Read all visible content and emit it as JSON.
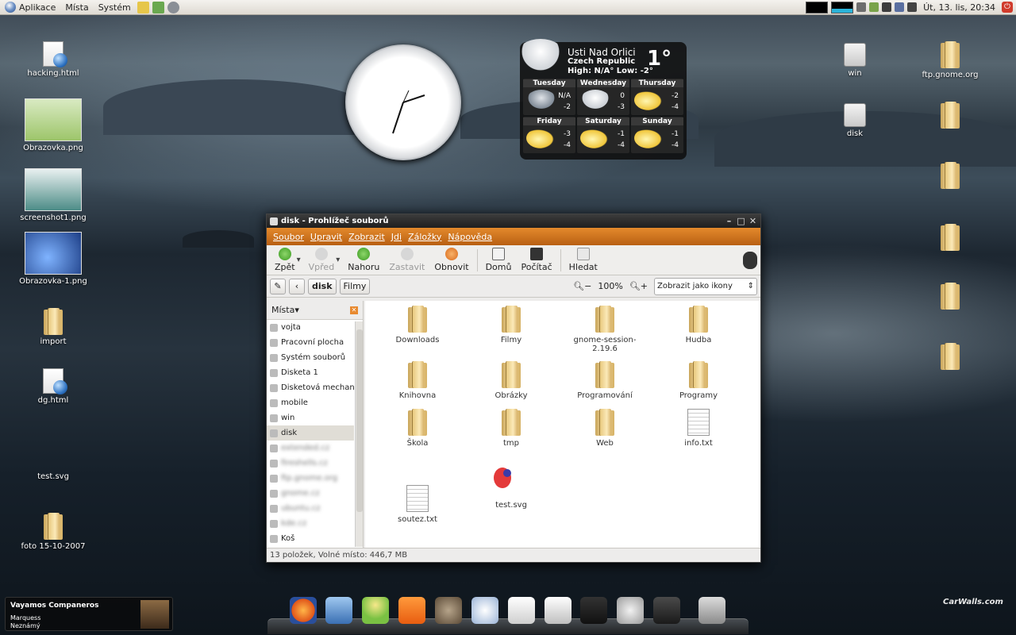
{
  "panel": {
    "menus": [
      "Aplikace",
      "Místa",
      "Systém"
    ],
    "clock": "Út, 13. lis, 20:34"
  },
  "desktop_left": [
    {
      "label": "hacking.html",
      "kind": "html"
    },
    {
      "label": "Obrazovka.png",
      "kind": "thumb-green"
    },
    {
      "label": "screenshot1.png",
      "kind": "thumb-teal"
    },
    {
      "label": "Obrazovka-1.png",
      "kind": "thumb-blue"
    },
    {
      "label": "import",
      "kind": "folder"
    },
    {
      "label": "dg.html",
      "kind": "html"
    },
    {
      "label": "test.svg",
      "kind": "blank"
    },
    {
      "label": "foto 15-10-2007",
      "kind": "folder"
    }
  ],
  "desktop_right": [
    {
      "label": "win",
      "kind": "drive"
    },
    {
      "label": "disk",
      "kind": "drive"
    },
    {
      "label": "ftp.gnome.org",
      "kind": "folder"
    }
  ],
  "weather": {
    "city": "Usti Nad Orlici",
    "country": "Czech Republic",
    "hilo": "High: N/A°   Low: -2°",
    "temp": "1°",
    "days": [
      {
        "name": "Tuesday",
        "hi": "N/A",
        "lo": "-2",
        "icon": "rain"
      },
      {
        "name": "Wednesday",
        "hi": "0",
        "lo": "-3",
        "icon": "snow"
      },
      {
        "name": "Thursday",
        "hi": "-2",
        "lo": "-4",
        "icon": "sun"
      },
      {
        "name": "Friday",
        "hi": "-3",
        "lo": "-4",
        "icon": "sun"
      },
      {
        "name": "Saturday",
        "hi": "-1",
        "lo": "-4",
        "icon": "sun"
      },
      {
        "name": "Sunday",
        "hi": "-1",
        "lo": "-4",
        "icon": "sun"
      }
    ]
  },
  "window": {
    "title": "disk - Prohlížeč souborů",
    "menu": [
      "Soubor",
      "Upravit",
      "Zobrazit",
      "Jdi",
      "Záložky",
      "Nápověda"
    ],
    "toolbar": {
      "back": "Zpět",
      "forward": "Vpřed",
      "up": "Nahoru",
      "stop": "Zastavit",
      "reload": "Obnovit",
      "home": "Domů",
      "computer": "Počítač",
      "search": "Hledat"
    },
    "path": {
      "current": "disk",
      "child": "Filmy"
    },
    "zoom": "100%",
    "view": "Zobrazit jako ikony",
    "sidebar_title": "Místa",
    "places": [
      {
        "label": "vojta",
        "blur": false
      },
      {
        "label": "Pracovní plocha",
        "blur": false
      },
      {
        "label": "Systém souborů",
        "blur": false
      },
      {
        "label": "Disketa 1",
        "blur": false
      },
      {
        "label": "Disketová mechani",
        "blur": false
      },
      {
        "label": "mobile",
        "blur": false
      },
      {
        "label": "win",
        "blur": false
      },
      {
        "label": "disk",
        "blur": false,
        "selected": true
      },
      {
        "label": "extended.cz",
        "blur": true
      },
      {
        "label": "fireshells.cz",
        "blur": true
      },
      {
        "label": "ftp.gnome.org",
        "blur": true
      },
      {
        "label": "gnome.cz",
        "blur": true
      },
      {
        "label": "ubuntu.cz",
        "blur": true
      },
      {
        "label": "kde.cz",
        "blur": true
      },
      {
        "label": "Koš",
        "blur": false
      }
    ],
    "files": [
      {
        "label": "Downloads",
        "kind": "folder"
      },
      {
        "label": "Filmy",
        "kind": "folder"
      },
      {
        "label": "gnome-session-2.19.6",
        "kind": "folder"
      },
      {
        "label": "Hudba",
        "kind": "folder"
      },
      {
        "label": "Knihovna",
        "kind": "folder"
      },
      {
        "label": "Obrázky",
        "kind": "folder"
      },
      {
        "label": "Programování",
        "kind": "folder"
      },
      {
        "label": "Programy",
        "kind": "folder"
      },
      {
        "label": "Škola",
        "kind": "folder"
      },
      {
        "label": "tmp",
        "kind": "folder"
      },
      {
        "label": "Web",
        "kind": "folder"
      },
      {
        "label": "info.txt",
        "kind": "txt"
      },
      {
        "label": "soutez.txt",
        "kind": "txt"
      },
      {
        "label": "test.svg",
        "kind": "svg"
      }
    ],
    "status": "13 položek, Volné místo: 446,7 MB"
  },
  "music": {
    "title": "Vayamos Companeros",
    "artist": "Marquess",
    "album": "Neznámý"
  },
  "dock_icons": [
    "firefox-icon",
    "mail-icon",
    "pidgin-icon",
    "rss-icon",
    "gimp-icon",
    "clock-icon",
    "media-icon",
    "ipod-icon",
    "terminal-icon",
    "search-icon",
    "drive-icon",
    "trash-icon"
  ],
  "watermark": "CarWalls.com"
}
